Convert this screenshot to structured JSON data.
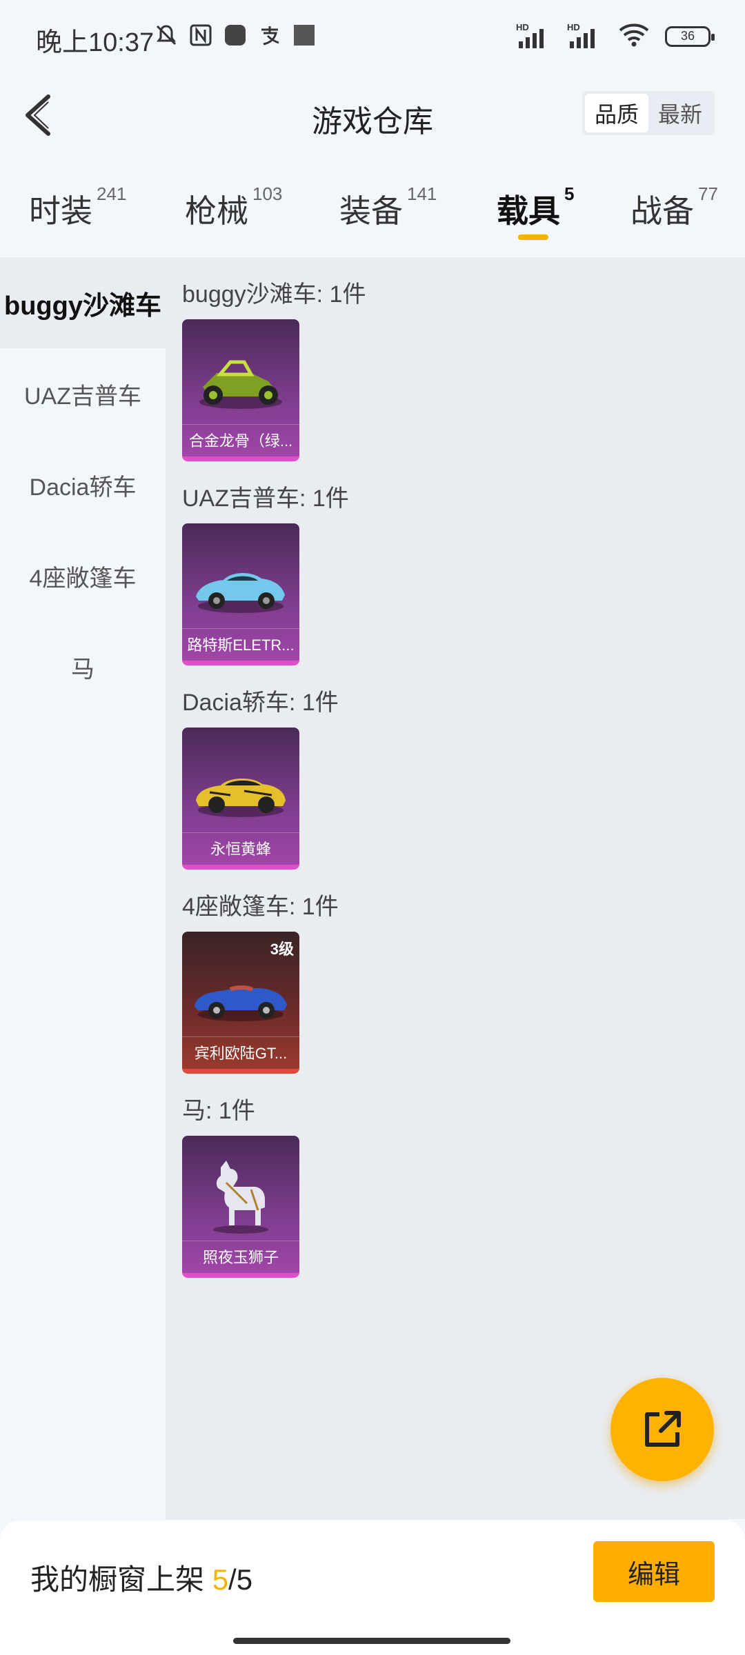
{
  "status_bar": {
    "time": "晚上10:37",
    "battery": "36",
    "icons": [
      "mute-icon",
      "nfc-icon",
      "app-icon",
      "alipay-icon",
      "square-icon",
      "hd-signal-icon",
      "hd-signal-icon",
      "wifi-icon",
      "battery-icon"
    ]
  },
  "header": {
    "title": "游戏仓库",
    "sort_options": [
      "品质",
      "最新"
    ],
    "active_sort": "品质"
  },
  "tabs": [
    {
      "label": "时装",
      "count": "241"
    },
    {
      "label": "枪械",
      "count": "103"
    },
    {
      "label": "装备",
      "count": "141"
    },
    {
      "label": "载具",
      "count": "5",
      "active": true
    },
    {
      "label": "战备",
      "count": "77"
    }
  ],
  "sidebar": {
    "items": [
      {
        "label": "buggy沙滩车",
        "active": true
      },
      {
        "label": "UAZ吉普车"
      },
      {
        "label": "Dacia轿车"
      },
      {
        "label": "4座敞篷车"
      },
      {
        "label": "马"
      }
    ]
  },
  "sections": [
    {
      "title": "buggy沙滩车: 1件",
      "item": {
        "name": "合金龙骨（绿...",
        "rarity_color": "#e04ec9"
      }
    },
    {
      "title": "UAZ吉普车: 1件",
      "item": {
        "name": "路特斯ELETR...",
        "rarity_color": "#e04ec9"
      }
    },
    {
      "title": "Dacia轿车: 1件",
      "item": {
        "name": "永恒黄蜂",
        "rarity_color": "#e04ec9"
      }
    },
    {
      "title": "4座敞篷车: 1件",
      "item": {
        "name": "宾利欧陆GT...",
        "level": "3级",
        "rarity_color": "#e04a3a"
      }
    },
    {
      "title": "马: 1件",
      "item": {
        "name": "照夜玉狮子",
        "rarity_color": "#e04ec9"
      }
    }
  ],
  "bottom_bar": {
    "label": "我的橱窗上架",
    "count": "5",
    "total": "/5",
    "edit_label": "编辑"
  },
  "colors": {
    "accent": "#ffb200",
    "purple_card": "#a046a8",
    "red_card": "#9a3a2e"
  }
}
